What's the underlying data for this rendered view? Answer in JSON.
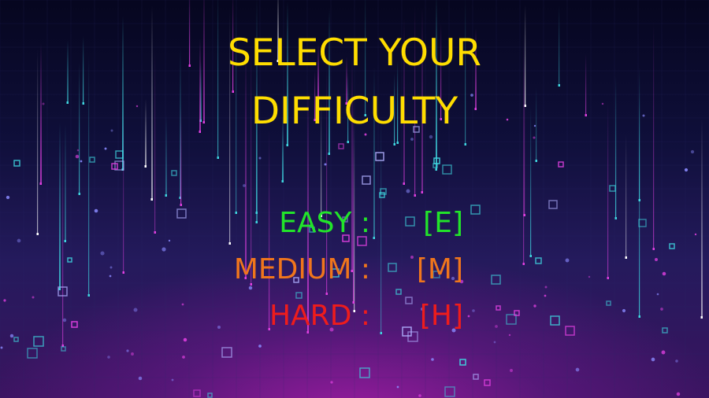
{
  "screen": {
    "title_line_1": "SELECT YOUR",
    "title_line_2": "DIFFICULTY"
  },
  "options": [
    {
      "label": "EASY :",
      "key": "[E]",
      "color": "#22e42a"
    },
    {
      "label": "MEDIUM :",
      "key": "[M]",
      "color": "#f0761c"
    },
    {
      "label": "HARD :",
      "key": "[H]",
      "color": "#ee1c1c"
    }
  ],
  "colors": {
    "title": "#ffdd00",
    "background_top": "#06061f",
    "background_glow": "#aa1eaa",
    "rain_cyan": "#3fd6e0",
    "rain_magenta": "#e040e0"
  }
}
